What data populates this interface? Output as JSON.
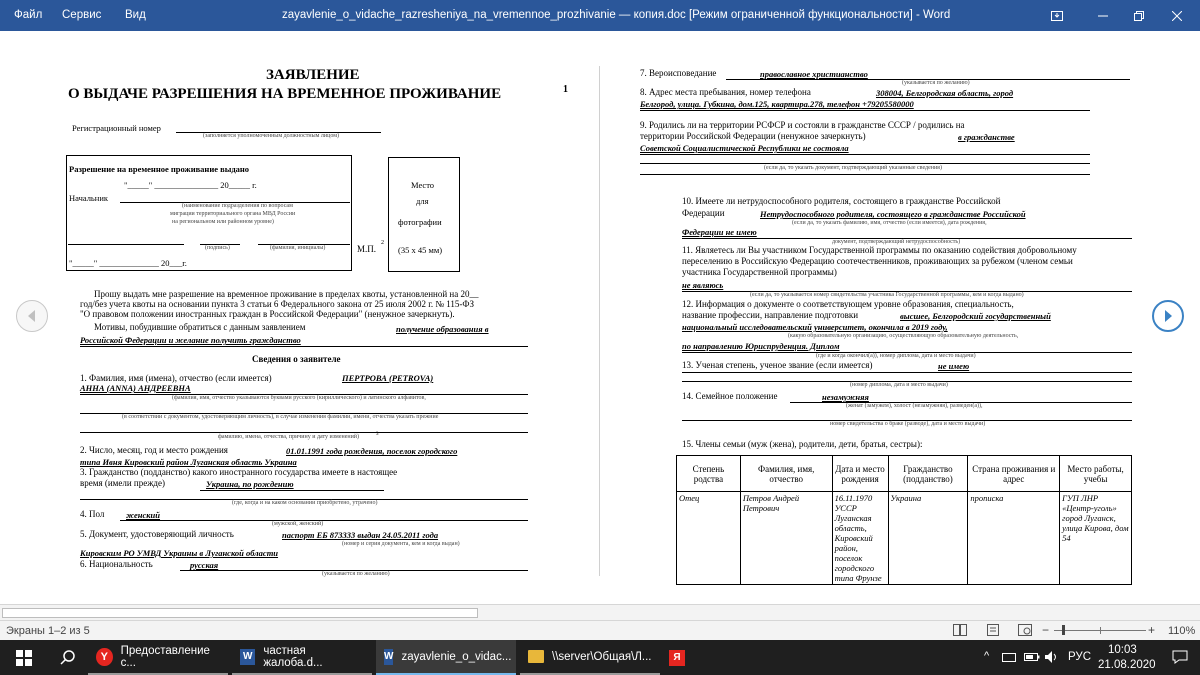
{
  "menubar": {
    "file": "Файл",
    "service": "Сервис",
    "view": "Вид"
  },
  "window_title": "zayavlenie_o_vidache_razresheniya_na_vremennoe_prozhivanie — копия.doc [Режим ограниченной функциональности] - Word",
  "left_page": {
    "title_1": "ЗАЯВЛЕНИЕ",
    "title_2": "О ВЫДАЧЕ РАЗРЕШЕНИЯ НА ВРЕМЕННОЕ ПРОЖИВАНИЕ",
    "title_sup": "1",
    "reg_label": "Регистрационный номер",
    "reg_hint": "(заполняется уполномоченным должностным лицом)",
    "permit_label": "Разрешение на временное проживание выдано",
    "date_row": "\"_____\" _______________ 20_____ г.",
    "chief_label": "Начальник",
    "chief_hint_1": "(наименование подразделения по вопросам",
    "chief_hint_2": "миграции территориального органа МВД России",
    "chief_hint_3": "на региональном или районном уровне)",
    "sign_hint": "(подпись)",
    "name_hint": "(фамилия, инициалы)",
    "mp": "М.П.",
    "mp_sup": "2",
    "date_row_2": "\"_____\" ______________ 20___г.",
    "photo_1": "Место",
    "photo_2": "для",
    "photo_3": "фотографии",
    "photo_4": "(35 х 45 мм)",
    "request_1": "Прошу выдать мне разрешение на временное проживание в пределах квоты, установленной на 20__",
    "request_2": "год/без учета квоты на основании пункта 3 статьи 6 Федерального закона от 25 июля 2002 г. № 115-ФЗ",
    "request_3": "\"О правовом положении иностранных граждан в Российской Федерации\" (ненужное зачеркнуть).",
    "motives_label": "Мотивы, побудившие обратиться с данным заявлением",
    "motives_value_1": "получение образования в",
    "motives_value_2": "Российской Федерации и желание получить гражданство",
    "section_title": "Сведения о заявителе",
    "q1_label": "1. Фамилия, имя (имена), отчество (если имеется)",
    "q1_value_1": "ПЕРТРОВА (PETROVA)",
    "q1_value_2": "АННА (ANNA) АНДРЕЕВНА",
    "q1_hint": "(фамилия, имя, отчество указываются буквами русского (кириллического) и латинского алфавитов,",
    "q1_hint_2": "(в соответствии с документом, удостоверяющим личность), в случае изменения фамилии, имени, отчества указать прежние",
    "q1_hint_3": "фамилию, имена, отчества, причину и дату изменений)",
    "q1_hint_sup": "3",
    "q2_label": "2. Число, месяц, год и место рождения",
    "q2_value_1": "01.01.1991 года рождения, поселок городского",
    "q2_value_2": "типа Ивня Кировский район Луганская область Украина",
    "q3_label_1": "3. Гражданство (подданство) какого иностранного государства имеете в настоящее",
    "q3_label_2": "время (имели прежде)",
    "q3_value": "Украина, по рождению",
    "q3_hint": "(где, когда и на каком основании приобретено, утрачено)",
    "q4_label": "4. Пол",
    "q4_value": "женский",
    "q4_hint": "(мужской, женский)",
    "q5_label": "5. Документ, удостоверяющий личность",
    "q5_value_1": "паспорт ЕБ 873333 выдан 24.05.2011 года",
    "q5_hint": "(номер и серия документа, кем и когда выдан)",
    "q5_value_2": "Кировским РО УМВД Украины в Луганской области",
    "q6_label": "6. Национальность",
    "q6_value": "русская",
    "q6_hint": "(указывается по желанию)"
  },
  "right_page": {
    "q7_label": "7. Вероисповедание",
    "q7_value": "православное христианство",
    "q7_hint": "(указывается по желанию)",
    "q8_label": "8. Адрес места пребывания, номер телефона",
    "q8_value_1": "308004, Белгородская область, город",
    "q8_value_2": "Белгород, улица. Губкина, дом.125, квартира.278, телефон +79205580000",
    "q9_label_1": "9. Родились ли на территории РСФСР и состояли в гражданстве СССР / родились на",
    "q9_label_2": "территории Российской Федерации (ненужное зачеркнуть)",
    "q9_value_1": "в гражданстве",
    "q9_value_2": "Советской Социалистической Республики не состояла",
    "q9_hint": "(если да, то указать документ, подтверждающий указанные сведения)",
    "q10_label_1": "10. Имеете ли нетрудоспособного родителя, состоящего в гражданстве Российской",
    "q10_label_2": "Федерации",
    "q10_value_1": "Нетрудоспособного родителя, состоящего в гражданстве Российской",
    "q10_hint_1": "(если да, то указать фамилию, имя, отчество (если имеется), дата рождения,",
    "q10_value_2": "Федерации не имею",
    "q10_hint_2": "документ, подтверждающий нетрудоспособность)",
    "q11_label_1": "11. Являетесь ли Вы участником Государственной программы по оказанию содействия добровольному",
    "q11_label_2": "переселению в Российскую Федерацию соотечественников, проживающих за рубежом (членом семьи",
    "q11_label_3": "участника Государственной программы)",
    "q11_value": "не являюсь",
    "q11_hint": "(если да, то указывается номер свидетельства участника Государственной программы, кем и когда выдано)",
    "q12_label_1": "12. Информация о документе о соответствующем уровне образования, специальность,",
    "q12_label_2": "название профессии, направление подготовки",
    "q12_value_1": "высшее, Белгородский государственный",
    "q12_value_2": "национальный исследовательский университет, окончила в 2019 году,",
    "q12_hint_1": "(какую образовательную организацию, осуществляющую образовательную деятельность,",
    "q12_value_3": "по направлению Юриспруденция. Диплом",
    "q12_hint_2": "(где и когда окончил(а)), номер диплома, дата и место выдачи)",
    "q13_label": "13. Ученая степень, ученое звание (если имеется)",
    "q13_value": "не имею",
    "q13_hint": "(номер диплома, дата и место выдачи)",
    "q14_label": "14. Семейное положение",
    "q14_value": "незамужняя",
    "q14_hint_1": "(женат (замужем), холост (незамужняя), разведен(а)),",
    "q14_hint_2": "номер свидетельства о браке (разводе), дата и место выдачи)",
    "q15_label": "15. Члены семьи (муж (жена), родители, дети, братья, сестры):",
    "table_headers": [
      "Степень родства",
      "Фамилия, имя, отчество",
      "Дата и место рождения",
      "Гражданство (подданство)",
      "Страна проживания и адрес",
      "Место работы, учебы"
    ],
    "table_rows": [
      [
        "Отец",
        "Петров Андрей Петрович",
        "16.11.1970 УССР Луганская область, Кировский район, поселок городского типа Фрунзе",
        "Украина",
        "прописка",
        "ГУП ЛНР «Центр-уголь» город Луганск, улица Кирова, дом 54"
      ]
    ]
  },
  "statusbar": {
    "pages": "Экраны 1–2 из 5",
    "zoom": "110%"
  },
  "taskbar": {
    "task1": "Предоставление с...",
    "task2": "частная жалоба.d...",
    "task3": "zayavlenie_o_vidac...",
    "task4": "\\\\server\\Общая\\Л...",
    "lang": "РУС",
    "time": "10:03",
    "date": "21.08.2020"
  },
  "colors": {
    "titlebar": "#2b579a",
    "taskbar": "#1f1f1f",
    "nav_arrow": "#3b82c4"
  }
}
